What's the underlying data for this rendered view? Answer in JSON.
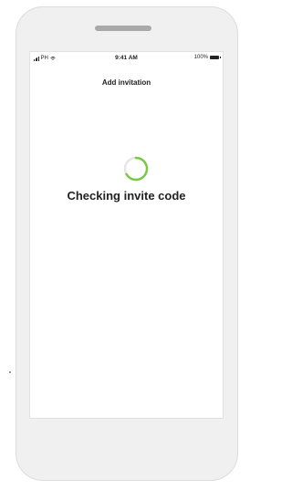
{
  "status_bar": {
    "carrier": "PH",
    "time": "9:41 AM",
    "battery_percent": "100%"
  },
  "header": {
    "title": "Add invitation"
  },
  "main": {
    "message": "Checking invite code"
  },
  "colors": {
    "accent": "#7ac943",
    "spinner_track": "#e6e6e6",
    "text": "#222222"
  },
  "icons": {
    "signal": "signal-icon",
    "wifi": "wifi-icon",
    "battery": "battery-icon",
    "spinner": "loading-spinner"
  }
}
